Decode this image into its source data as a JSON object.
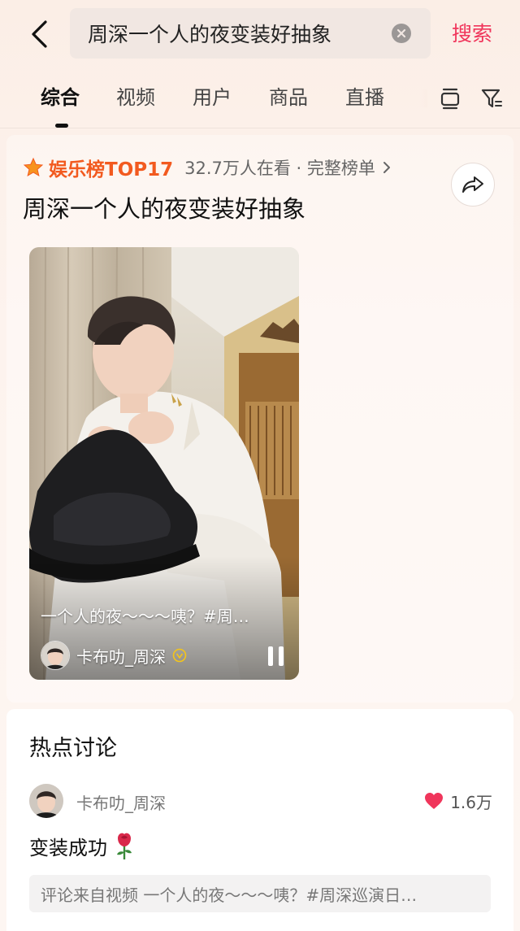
{
  "header": {
    "back_icon": "chevron-left-icon",
    "search_query": "周深一个人的夜变装好抽象",
    "clear_icon": "clear-circle-icon",
    "search_label": "搜索",
    "accent_color": "#f0355b"
  },
  "tabs": {
    "items": [
      {
        "label": "综合",
        "active": true
      },
      {
        "label": "视频",
        "active": false
      },
      {
        "label": "用户",
        "active": false
      },
      {
        "label": "商品",
        "active": false
      },
      {
        "label": "直播",
        "active": false
      }
    ],
    "icons": [
      "layout-toggle-icon",
      "filter-icon"
    ]
  },
  "hot_topic": {
    "star_icon": "star-icon",
    "rank_label": "娱乐榜TOP17",
    "rank_color": "#f25a1f",
    "meta": "32.7万人在看 · 完整榜单",
    "title": "周深一个人的夜变装好抽象",
    "share_icon": "share-icon"
  },
  "video": {
    "caption": "一个人的夜～～～咦？#周…",
    "author": "卡布叻_周深",
    "verified_icon": "verified-badge-icon",
    "pause_icon": "pause-icon"
  },
  "discussion": {
    "title": "热点讨论",
    "comment": {
      "user": "卡布叻_周深",
      "likes": "1.6万",
      "heart_icon": "heart-icon",
      "text": "变装成功",
      "emoji_icon": "rose-icon",
      "source": "评论来自视频 一个人的夜～～～咦？#周深巡演日…"
    }
  }
}
